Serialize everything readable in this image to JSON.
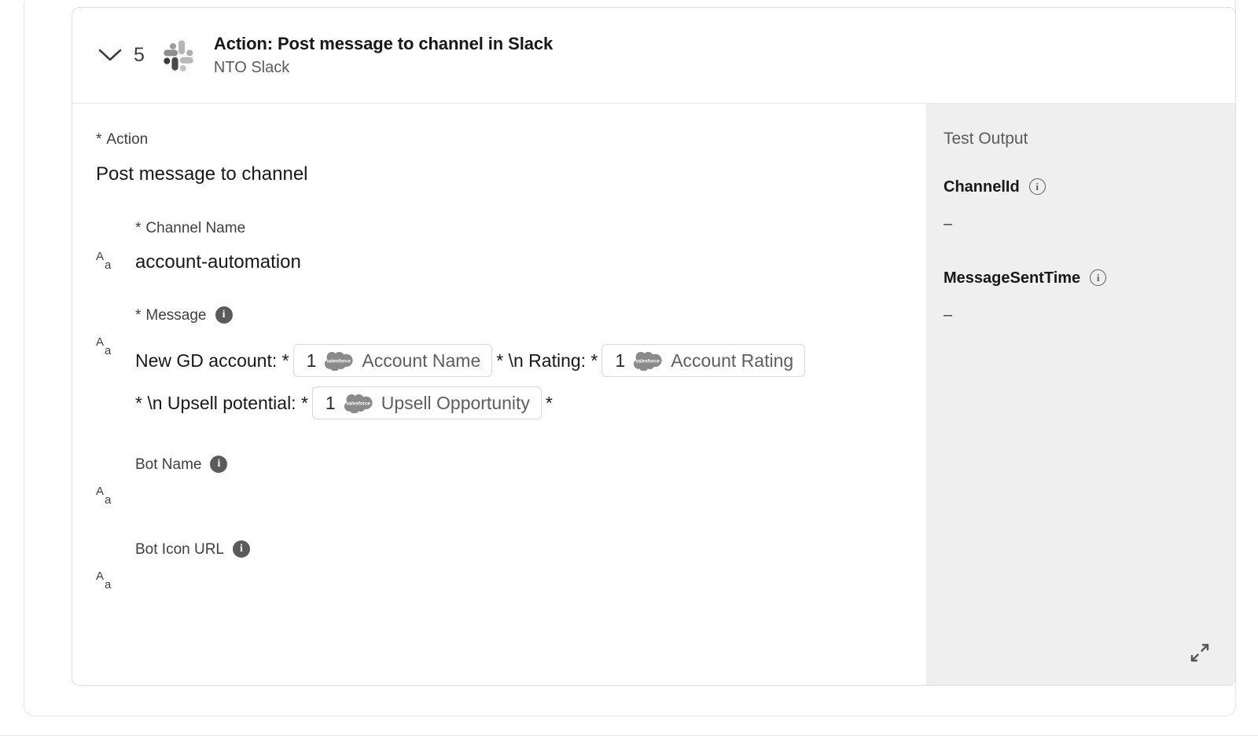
{
  "card": {
    "step_number": "5",
    "title": "Action: Post message to channel in Slack",
    "subtitle": "NTO Slack",
    "collapse_icon": "chevron-down-icon",
    "app_icon": "slack-logo-icon"
  },
  "form": {
    "action": {
      "label_required_mark": "*",
      "label": "Action",
      "value": "Post message to channel"
    },
    "channel_name": {
      "label_required_mark": "*",
      "label": "Channel Name",
      "value": "account-automation",
      "type_icon": "text-type-icon"
    },
    "message": {
      "label_required_mark": "*",
      "label": "Message",
      "info_icon": "info-filled-icon",
      "type_icon": "text-type-icon",
      "tokens": [
        {
          "kind": "text",
          "text": "New GD account: *"
        },
        {
          "kind": "chip",
          "num": "1",
          "logo": "salesforce-cloud-icon",
          "label": "Account Name"
        },
        {
          "kind": "text",
          "text": "* \\n Rating: *"
        },
        {
          "kind": "chip",
          "num": "1",
          "logo": "salesforce-cloud-icon",
          "label": "Account Rating"
        },
        {
          "kind": "text",
          "text": "* \\n Upsell potential: *"
        },
        {
          "kind": "chip",
          "num": "1",
          "logo": "salesforce-cloud-icon",
          "label": "Upsell Opportunity"
        },
        {
          "kind": "text",
          "text": "*"
        }
      ]
    },
    "bot_name": {
      "label": "Bot Name",
      "info_icon": "info-filled-icon",
      "type_icon": "text-type-icon",
      "value": ""
    },
    "bot_icon_url": {
      "label": "Bot Icon URL",
      "info_icon": "info-filled-icon",
      "type_icon": "text-type-icon",
      "value": ""
    }
  },
  "test_output": {
    "title": "Test Output",
    "expand_icon": "expand-diagonal-icon",
    "items": [
      {
        "name": "ChannelId",
        "value": "–",
        "info_icon": "info-outline-icon"
      },
      {
        "name": "MessageSentTime",
        "value": "–",
        "info_icon": "info-outline-icon"
      }
    ]
  },
  "colors": {
    "panel_gray": "#efefef",
    "card_border": "#e0e0e0",
    "text_primary": "#181818",
    "text_secondary": "#5b5b5b",
    "chip_border": "#d8d8d8",
    "connector": "#aeaeae"
  },
  "info_glyph": "i"
}
